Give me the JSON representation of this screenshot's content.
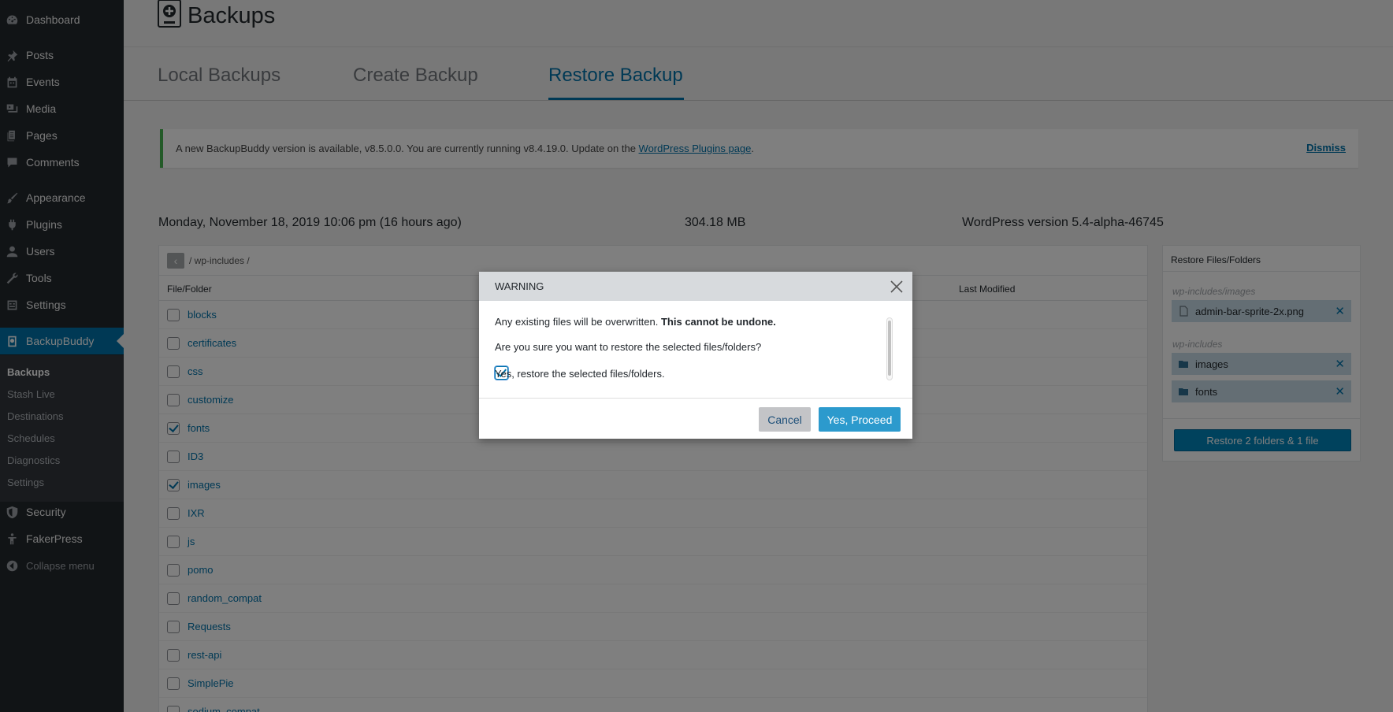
{
  "sidebar": {
    "items": [
      {
        "label": "Dashboard",
        "icon": "dashboard-icon"
      },
      {
        "label": "Posts",
        "icon": "pin-icon"
      },
      {
        "label": "Events",
        "icon": "calendar-icon"
      },
      {
        "label": "Media",
        "icon": "media-icon"
      },
      {
        "label": "Pages",
        "icon": "pages-icon"
      },
      {
        "label": "Comments",
        "icon": "comment-icon"
      },
      {
        "label": "Appearance",
        "icon": "brush-icon"
      },
      {
        "label": "Plugins",
        "icon": "plugin-icon"
      },
      {
        "label": "Users",
        "icon": "user-icon"
      },
      {
        "label": "Tools",
        "icon": "wrench-icon"
      },
      {
        "label": "Settings",
        "icon": "settings-icon"
      },
      {
        "label": "BackupBuddy",
        "icon": "backupbuddy-icon"
      },
      {
        "label": "Security",
        "icon": "shield-icon"
      },
      {
        "label": "FakerPress",
        "icon": "person-icon"
      }
    ],
    "submenu": [
      "Backups",
      "Stash Live",
      "Destinations",
      "Schedules",
      "Diagnostics",
      "Settings"
    ],
    "collapse_label": "Collapse menu"
  },
  "header": {
    "title": "Backups",
    "tabs": [
      "Local Backups",
      "Create Backup",
      "Restore Backup"
    ],
    "active_tab": "Restore Backup"
  },
  "notice": {
    "text": "A new BackupBuddy version is available, v8.5.0.0. You are currently running v8.4.19.0. Update on the ",
    "link": "WordPress Plugins page",
    "suffix": ".",
    "dismiss": "Dismiss"
  },
  "backup": {
    "date": "Monday, November 18, 2019 10:06 pm (16 hours ago)",
    "size": "304.18 MB",
    "wp_version": "WordPress version 5.4-alpha-46745"
  },
  "browser": {
    "back_symbol": "‹",
    "path": "/ wp-includes /",
    "col_file": "File/Folder",
    "col_modified": "Last Modified",
    "rows": [
      {
        "name": "blocks",
        "checked": false
      },
      {
        "name": "certificates",
        "checked": false
      },
      {
        "name": "css",
        "checked": false
      },
      {
        "name": "customize",
        "checked": false
      },
      {
        "name": "fonts",
        "checked": true
      },
      {
        "name": "ID3",
        "checked": false
      },
      {
        "name": "images",
        "checked": true
      },
      {
        "name": "IXR",
        "checked": false
      },
      {
        "name": "js",
        "checked": false
      },
      {
        "name": "pomo",
        "checked": false
      },
      {
        "name": "random_compat",
        "checked": false
      },
      {
        "name": "Requests",
        "checked": false
      },
      {
        "name": "rest-api",
        "checked": false
      },
      {
        "name": "SimplePie",
        "checked": false
      },
      {
        "name": "sodium_compat",
        "checked": false
      }
    ]
  },
  "restore_panel": {
    "title": "Restore Files/Folders",
    "group1_label": "wp-includes/images",
    "group1_items": [
      {
        "name": "admin-bar-sprite-2x.png",
        "icon": "file-icon"
      }
    ],
    "group2_label": "wp-includes",
    "group2_items": [
      {
        "name": "images",
        "icon": "folder-icon"
      },
      {
        "name": "fonts",
        "icon": "folder-icon"
      }
    ],
    "remove_symbol": "✕",
    "button": "Restore 2 folders & 1 file"
  },
  "modal": {
    "title": "WARNING",
    "line1": "Any existing files will be overwritten. ",
    "line1_bold": "This cannot be undone.",
    "line2": "Are you sure you want to restore the selected files/folders?",
    "confirm_label": "Yes, restore the selected files/folders.",
    "confirm_checked": true,
    "cancel": "Cancel",
    "proceed": "Yes, Proceed"
  },
  "colors": {
    "sidebar_bg": "#23282d",
    "accent": "#0073aa",
    "notice_border": "#46b450",
    "proceed_button": "#2c9acd"
  }
}
